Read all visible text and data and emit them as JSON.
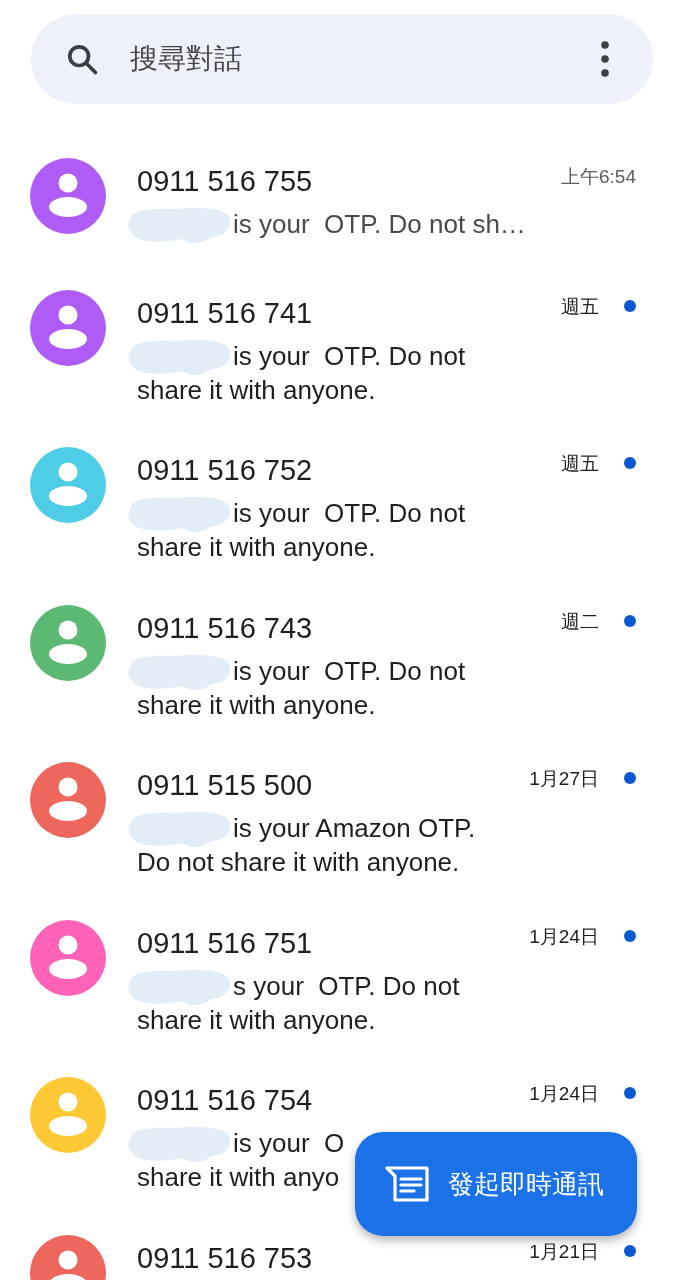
{
  "search": {
    "placeholder": "搜尋對話"
  },
  "conversations": [
    {
      "name": "0911 516 755",
      "preview": [
        "is your  OTP. Do not sh…"
      ],
      "time": "上午6:54",
      "unread": false,
      "color": "#af5cf7"
    },
    {
      "name": "0911 516 741",
      "preview": [
        "is your  OTP. Do not",
        "share it with anyone."
      ],
      "time": "週五",
      "unread": true,
      "color": "#af5cf7"
    },
    {
      "name": "0911 516 752",
      "preview": [
        "is your  OTP. Do not",
        "share it with anyone."
      ],
      "time": "週五",
      "unread": true,
      "color": "#4ecde6"
    },
    {
      "name": "0911 516 743",
      "preview": [
        "is your  OTP. Do not",
        "share it with anyone."
      ],
      "time": "週二",
      "unread": true,
      "color": "#5bb974"
    },
    {
      "name": "0911 515 500",
      "preview": [
        "is your Amazon OTP.",
        "Do not share it with anyone."
      ],
      "time": "1月27日",
      "unread": true,
      "color": "#ee675c"
    },
    {
      "name": "0911 516 751",
      "preview": [
        "s your  OTP. Do not",
        "share it with anyone."
      ],
      "time": "1月24日",
      "unread": true,
      "color": "#ff63b8"
    },
    {
      "name": "0911 516 754",
      "preview": [
        "is your  O",
        "share it with anyo"
      ],
      "time": "1月24日",
      "unread": true,
      "color": "#fcc934"
    },
    {
      "name": "0911 516 753",
      "time": "1月21日",
      "unread": true,
      "color": "#ee675c"
    }
  ],
  "fab": {
    "label": "發起即時通訊"
  }
}
